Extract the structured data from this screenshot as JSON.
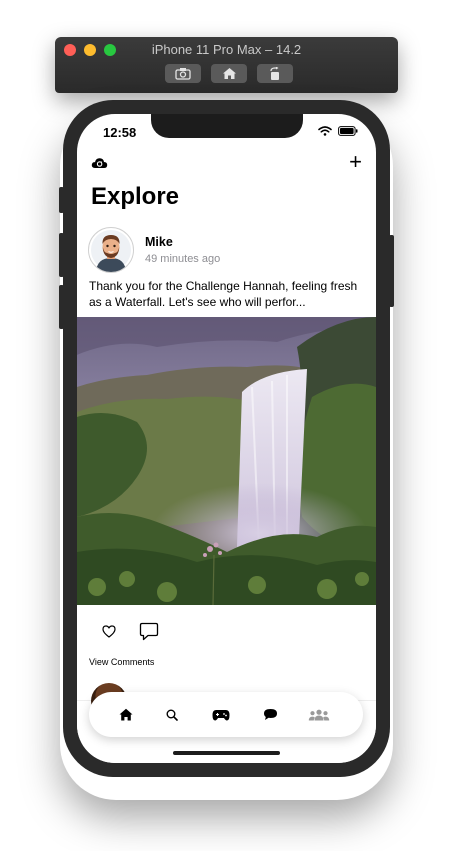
{
  "simulator": {
    "title": "iPhone 11 Pro Max – 14.2",
    "buttons": [
      "screenshot-icon",
      "home-icon",
      "rotate-icon"
    ]
  },
  "status_bar": {
    "time": "12:58"
  },
  "header": {
    "title": "Explore",
    "left_icon": "cloud-refresh-icon",
    "right_icon": "plus-icon",
    "plus_label": "+"
  },
  "post": {
    "author": "Mike",
    "time": "49 minutes ago",
    "text": "Thank you for the Challenge Hannah, feeling fresh as a Waterfall. Let's see who will perfor...",
    "image": "waterfall-photo",
    "actions": [
      "heart-icon",
      "comment-icon"
    ],
    "view_comments": "View Comments"
  },
  "tab_bar": {
    "items": [
      "home-icon",
      "search-icon",
      "gamepad-icon",
      "chat-icon",
      "people-icon"
    ],
    "active": "home-icon"
  }
}
